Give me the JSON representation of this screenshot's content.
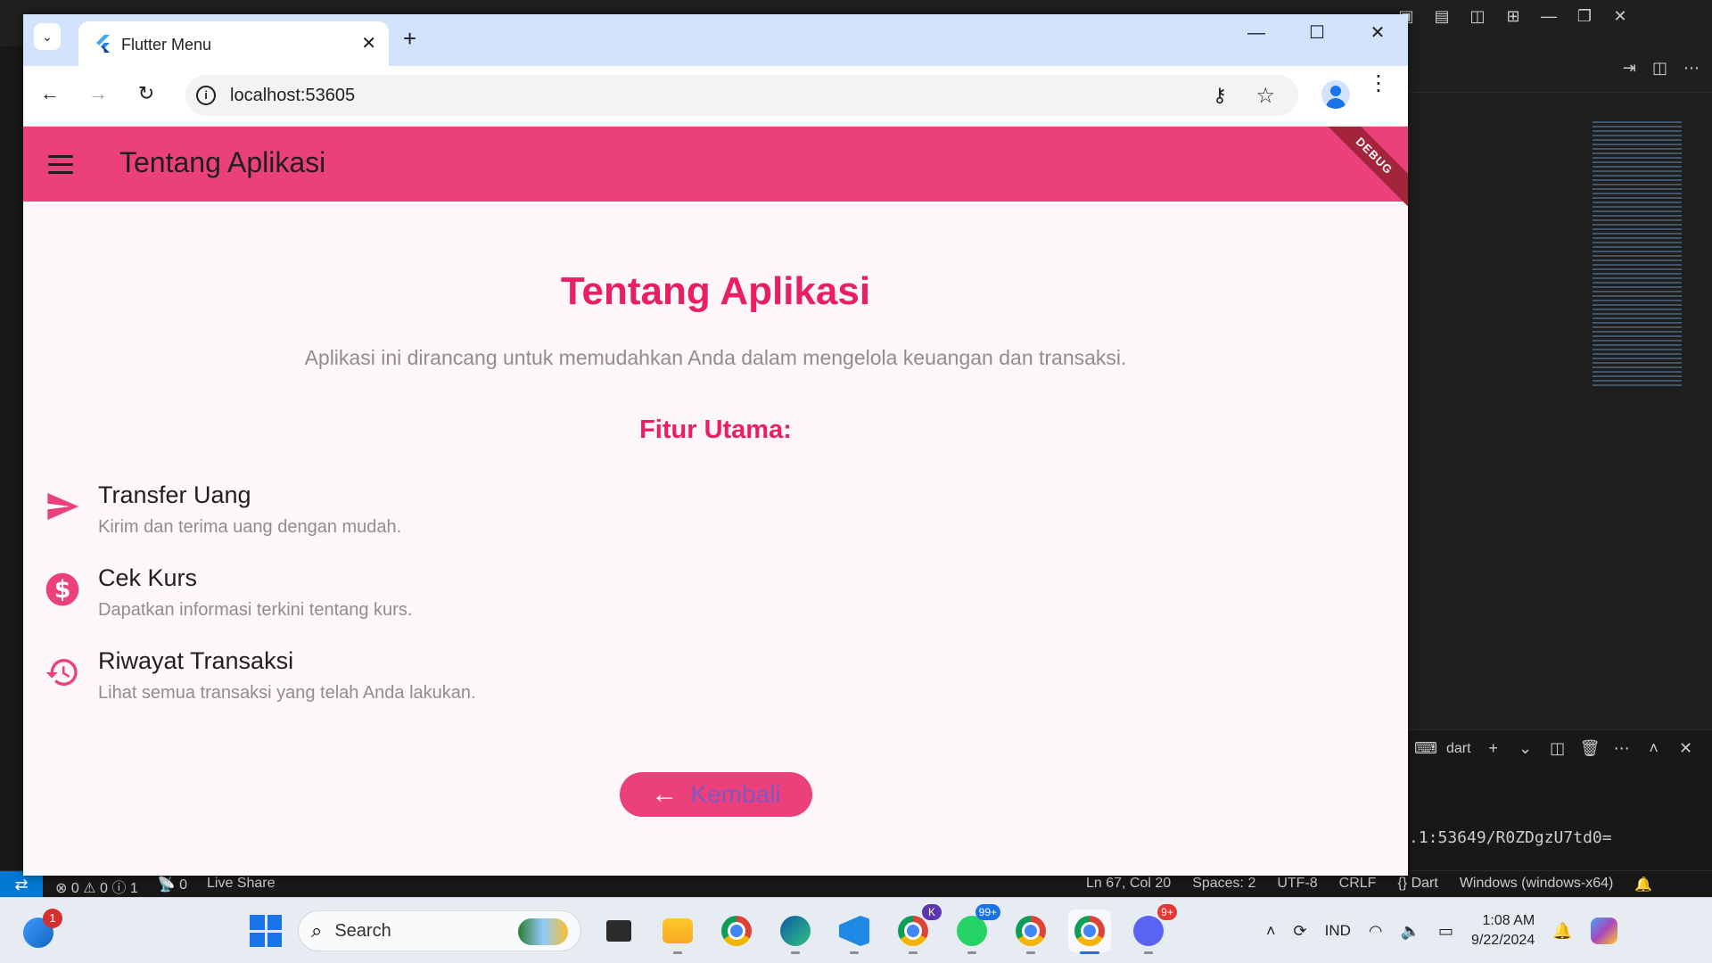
{
  "browser": {
    "tab_title": "Flutter Menu",
    "url": "localhost:53605"
  },
  "app": {
    "appbar_title": "Tentang Aplikasi",
    "debug_banner": "DEBUG",
    "heading": "Tentang Aplikasi",
    "description": "Aplikasi ini dirancang untuk memudahkan Anda dalam mengelola keuangan dan transaksi.",
    "features_title": "Fitur Utama:",
    "features": [
      {
        "icon": "send-icon",
        "title": "Transfer Uang",
        "subtitle": "Kirim dan terima uang dengan mudah."
      },
      {
        "icon": "dollar-icon",
        "title": "Cek Kurs",
        "subtitle": "Dapatkan informasi terkini tentang kurs."
      },
      {
        "icon": "history-icon",
        "title": "Riwayat Transaksi",
        "subtitle": "Lihat semua transaksi yang telah Anda lakukan."
      }
    ],
    "back_button": "Kembali",
    "colors": {
      "appbar": "#ec407a",
      "accent": "#e91e63",
      "background": "#fdf6fa"
    }
  },
  "vscode": {
    "terminal_tab": "dart",
    "terminal_output": ".1:53649/R0ZDgzU7td0=",
    "status": {
      "errors": "0",
      "warnings": "0",
      "info": "1",
      "ports": "0",
      "live_share": "Live Share",
      "cursor": "Ln 67, Col 20",
      "spaces": "Spaces: 2",
      "encoding": "UTF-8",
      "eol": "CRLF",
      "language": "Dart",
      "platform": "Windows (windows-x64)"
    }
  },
  "taskbar": {
    "search_label": "Search",
    "widget_badge": "1",
    "whatsapp_badge": "99+",
    "discord_badge": "9+",
    "teams_badge": "K",
    "language": "IND",
    "time": "1:08 AM",
    "date": "9/22/2024"
  }
}
